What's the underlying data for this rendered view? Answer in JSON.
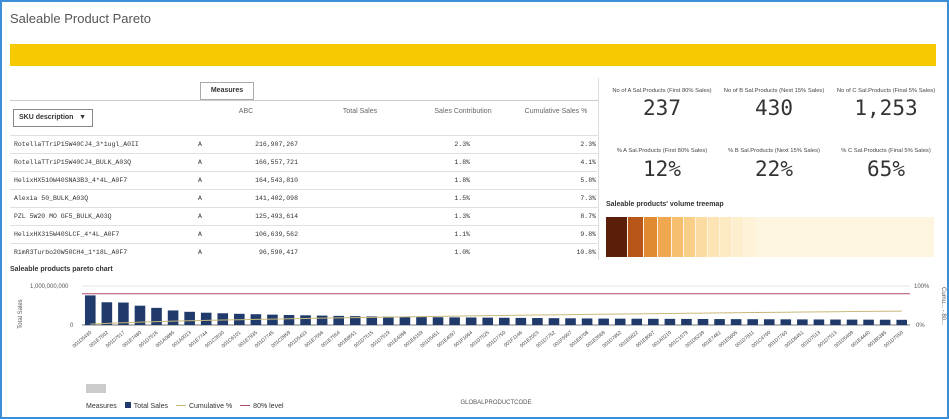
{
  "app_title": "Saleable Product Pareto",
  "table": {
    "measures_tab": "Measures",
    "sku_dropdown": "SKU description",
    "headers": {
      "abc": "ABC",
      "total_sales": "Total Sales",
      "sales_contribution": "Sales Contribution",
      "cumulative": "Cumulative Sales %"
    },
    "rows": [
      {
        "sku": "RotellaTTriP15W40CJ4_3*1ugl_A0II",
        "abc": "A",
        "total_sales": "216,907,267",
        "sales_contribution": "2.3%",
        "cumulative": "2.3%"
      },
      {
        "sku": "RotellaTTriP15W40CJ4_BULK_A03Q",
        "abc": "A",
        "total_sales": "166,557,721",
        "sales_contribution": "1.8%",
        "cumulative": "4.1%"
      },
      {
        "sku": "HelixHX510W40SNA3B3_4*4L_A0F7",
        "abc": "A",
        "total_sales": "164,543,810",
        "sales_contribution": "1.8%",
        "cumulative": "5.8%"
      },
      {
        "sku": "Alexia 50_BULK_A03Q",
        "abc": "A",
        "total_sales": "141,402,098",
        "sales_contribution": "1.5%",
        "cumulative": "7.3%"
      },
      {
        "sku": "PZL 5W20 MO GF5_BULK_A03Q",
        "abc": "A",
        "total_sales": "125,493,614",
        "sales_contribution": "1.3%",
        "cumulative": "8.7%"
      },
      {
        "sku": "HelixHX315W40SLCF_4*4L_A0F7",
        "abc": "A",
        "total_sales": "106,639,562",
        "sales_contribution": "1.1%",
        "cumulative": "9.8%"
      },
      {
        "sku": "RimR3Turbo20W50CH4_1*18L_A0F7",
        "abc": "A",
        "total_sales": "96,590,417",
        "sales_contribution": "1.0%",
        "cumulative": "10.8%"
      }
    ]
  },
  "kpis": [
    {
      "label": "No of A Sal.Products (First 80% Sales)",
      "value": "237"
    },
    {
      "label": "No of B Sal.Products (Next 15% Sales)",
      "value": "430"
    },
    {
      "label": "No of C Sal.Products (Final 5% Sales)",
      "value": "1,253"
    },
    {
      "label": "% A Sal.Products (First 80% Sales)",
      "value": "12%"
    },
    {
      "label": "% B Sal.Products (Next 15% Sales)",
      "value": "22%"
    },
    {
      "label": "% C Sal.Products (Final 5% Sales)",
      "value": "65%"
    }
  ],
  "treemap": {
    "title": "Saleable products' volume treemap"
  },
  "chart": {
    "title": "Saleable products pareto chart",
    "ylabel": "Total Sales",
    "y2label": "Cumu... - 80...",
    "xlabel": "GLOBALPRODUCTCODE",
    "y_tick_top": "1,000,000,000",
    "y_tick_zero": "0",
    "y2_tick_top": "100%",
    "y2_tick_zero": "0%",
    "legend_title": "Measures",
    "legend_total": "Total Sales",
    "legend_cum": "Cumulative %",
    "legend_80": "80% level"
  },
  "chart_data": {
    "type": "bar",
    "ylim": [
      0,
      1000000000
    ],
    "y2lim": [
      0,
      100
    ],
    "categories": [
      "001D5430",
      "001E7502",
      "001D7517",
      "001E7480",
      "001D7516",
      "001A0895",
      "001A0013",
      "001E7744",
      "001C3530",
      "001C6101",
      "001E7935",
      "001D7745",
      "001C0959",
      "001D5433",
      "001E7556",
      "001E7554",
      "001B8551",
      "001D7515",
      "001D7519",
      "001E4098",
      "001E6159",
      "001D5451",
      "001E4097",
      "001F1664",
      "001D7525",
      "001D7750",
      "001F1146",
      "001E2023",
      "001D7752",
      "001F5907",
      "001E8708",
      "001E3568",
      "001D7852",
      "001E6822",
      "001E8007",
      "001A0210",
      "001C1579",
      "001D6239",
      "001E7481",
      "001E5605",
      "001D7811",
      "001C4700",
      "001D7760",
      "001D6451",
      "001D7513",
      "001D7513",
      "001D5409",
      "001E4440",
      "001B5385",
      "001D7550"
    ],
    "series": [
      {
        "name": "Total Sales",
        "values": [
          216907267,
          166557721,
          164543810,
          141402098,
          125493614,
          106639562,
          96590417,
          90000000,
          86000000,
          82000000,
          79000000,
          76000000,
          73000000,
          71000000,
          69000000,
          67000000,
          65000000,
          63000000,
          61000000,
          60000000,
          58000000,
          57000000,
          56000000,
          55000000,
          54000000,
          53000000,
          52000000,
          51000000,
          50000000,
          49000000,
          48000000,
          47000000,
          46500000,
          46000000,
          45500000,
          45000000,
          44500000,
          44000000,
          43500000,
          43000000,
          42500000,
          42000000,
          41500000,
          41000000,
          40500000,
          40000000,
          39500000,
          39000000,
          38500000,
          38000000
        ]
      },
      {
        "name": "Cumulative %",
        "values": [
          2.3,
          4.1,
          5.8,
          7.3,
          8.7,
          9.8,
          10.8,
          11.8,
          12.7,
          13.6,
          14.4,
          15.2,
          16.0,
          16.8,
          17.5,
          18.2,
          18.9,
          19.6,
          20.2,
          20.9,
          21.5,
          22.1,
          22.7,
          23.3,
          23.9,
          24.4,
          25.0,
          25.5,
          26.1,
          26.6,
          27.1,
          27.6,
          28.1,
          28.6,
          29.1,
          29.6,
          30.1,
          30.5,
          31.0,
          31.5,
          31.9,
          32.4,
          32.8,
          33.2,
          33.7,
          34.1,
          34.5,
          34.9,
          35.3,
          35.7
        ]
      },
      {
        "name": "80% level",
        "values": [
          80
        ]
      }
    ],
    "colors": {
      "bars": "#1f3a6b",
      "cumulative": "#c8b97a",
      "level80": "#b04a6a"
    }
  },
  "treemap_colors": [
    "#5a1e0a",
    "#b8561a",
    "#e08a32",
    "#f0a850",
    "#f6bf6e",
    "#f9cf88",
    "#fbdba0",
    "#fce4b4",
    "#fde9c2",
    "#fdeecd",
    "#fef2d8",
    "#fef5e0"
  ]
}
